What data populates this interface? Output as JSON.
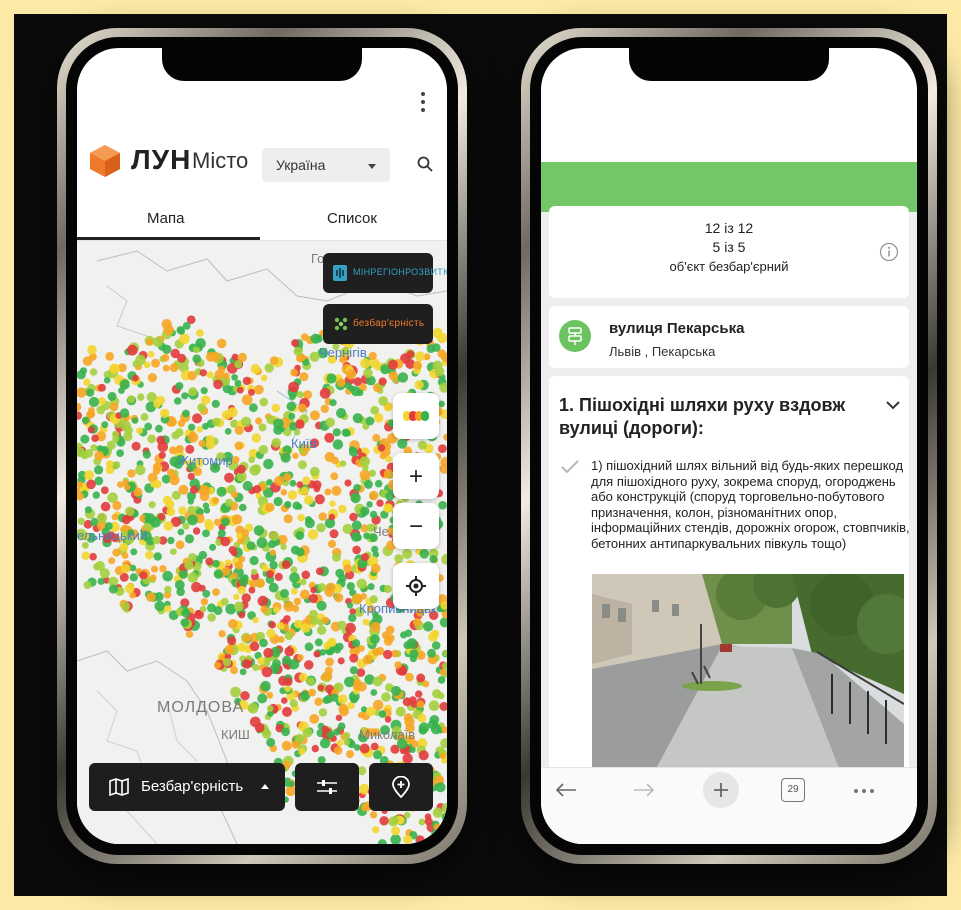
{
  "left_phone": {
    "logo": {
      "brand": "ЛУН",
      "sub": "Місто",
      "accent": "#f07a2b"
    },
    "country_select": {
      "value": "Україна"
    },
    "tabs": [
      {
        "label": "Мапа",
        "active": true
      },
      {
        "label": "Список",
        "active": false
      }
    ],
    "badges": [
      {
        "label": "МІНРЕГІОНРОЗВИТКУ",
        "color": "#35a1c5",
        "icon": "ministry-icon"
      },
      {
        "label": "безбар'єрність",
        "color": "#f07a2b",
        "icon": "barrier-free-icon"
      }
    ],
    "map_labels": [
      {
        "text": "Го"
      },
      {
        "text": "Чернігів"
      },
      {
        "text": "Житомир"
      },
      {
        "text": "Київ"
      },
      {
        "text": "ельницький"
      },
      {
        "text": "Че"
      },
      {
        "text": "Кропивницьк"
      },
      {
        "text": "МОЛДОВА"
      },
      {
        "text": "КИШ"
      },
      {
        "text": "Миколаїв"
      }
    ],
    "map_controls": {
      "zoom_in": "+",
      "zoom_out": "−"
    },
    "marker_colors": [
      "#e23b3b",
      "#f6a623",
      "#f2d62f",
      "#a4cf3d",
      "#37b24d"
    ],
    "bottom_bar": {
      "layer_label": "Безбар'єрність"
    }
  },
  "right_phone": {
    "counts": [
      "12 із 12",
      "5 із 5",
      "об'єкт безбар'єрний"
    ],
    "street": {
      "name": "вулиця Пекарська",
      "location": "Львів , Пекарська"
    },
    "section": {
      "title": "1. Пішохідні шляхи руху вздовж вулиці (дороги):",
      "requirement": "1) пішохідний шлях вільний від будь-яких перешкод для пішохідного руху, зокрема споруд, огороджень або конструкцій (споруд торговельно-побутового призначення, колон, різноманітних опор, інформаційних стендів, дорожніх огорож, стовпчиків, бетонних антипаркувальних півкуль тощо)"
    },
    "browser_bar": {
      "tab_count": "29"
    },
    "accent_green": "#74c768"
  }
}
